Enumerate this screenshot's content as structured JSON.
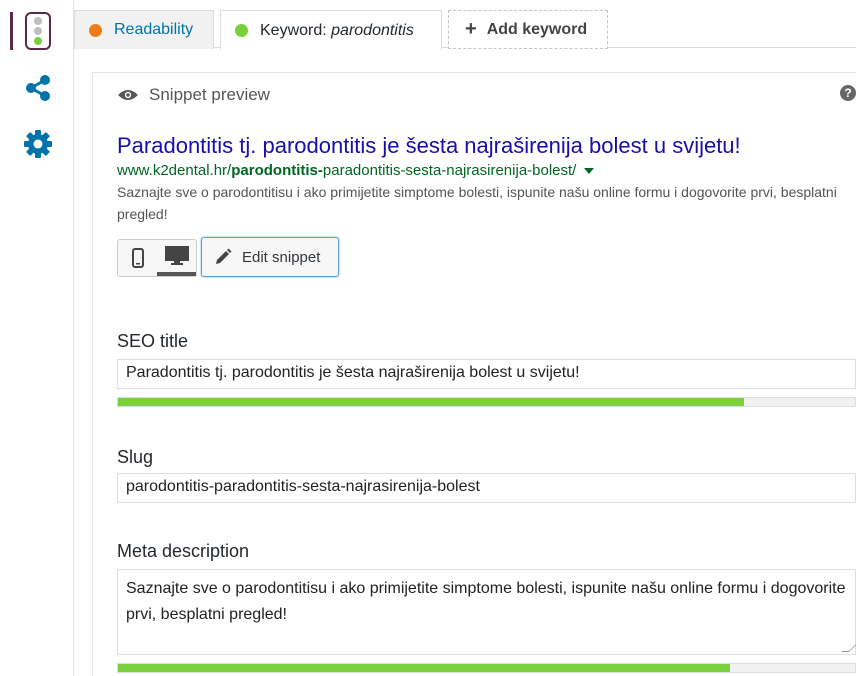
{
  "tabs": {
    "readability": {
      "label": "Readability",
      "dot_color": "#ee7c1b"
    },
    "keyword": {
      "prefix": "Keyword: ",
      "value": "parodontitis",
      "dot_color": "#7ad03a"
    },
    "add": {
      "label": "Add keyword",
      "icon": "plus-icon"
    }
  },
  "sidebar": {
    "icons": [
      "traffic-light-icon",
      "share-icon",
      "gear-icon"
    ],
    "accent": "#0073aa"
  },
  "snippet": {
    "heading": "Snippet preview",
    "help": "?",
    "title": "Paradontitis tj. parodontitis je šesta najraširenija bolest u svijetu!",
    "url_base": "www.k2dental.hr/",
    "url_bold": "parodontitis-",
    "url_rest": "paradontitis-sesta-najrasirenija-bolest/",
    "description": "Saznajte sve o parodontitisu i ako primijetite simptome bolesti, ispunite našu online formu i dogovorite prvi, besplatni pregled!",
    "edit_label": "Edit snippet"
  },
  "fields": {
    "seo_title": {
      "label": "SEO title",
      "value": "Paradontitis tj. parodontitis je šesta najraširenija bolest u svijetu!",
      "progress": 0.85,
      "progress_color": "#7ad03a"
    },
    "slug": {
      "label": "Slug",
      "value": "parodontitis-paradontitis-sesta-najrasirenija-bolest"
    },
    "meta": {
      "label": "Meta description",
      "value": "Saznajte sve o parodontitisu i ako primijetite simptome bolesti, ispunite našu online formu i dogovorite prvi, besplatni pregled!",
      "progress": 0.83,
      "progress_color": "#7ad03a"
    }
  }
}
